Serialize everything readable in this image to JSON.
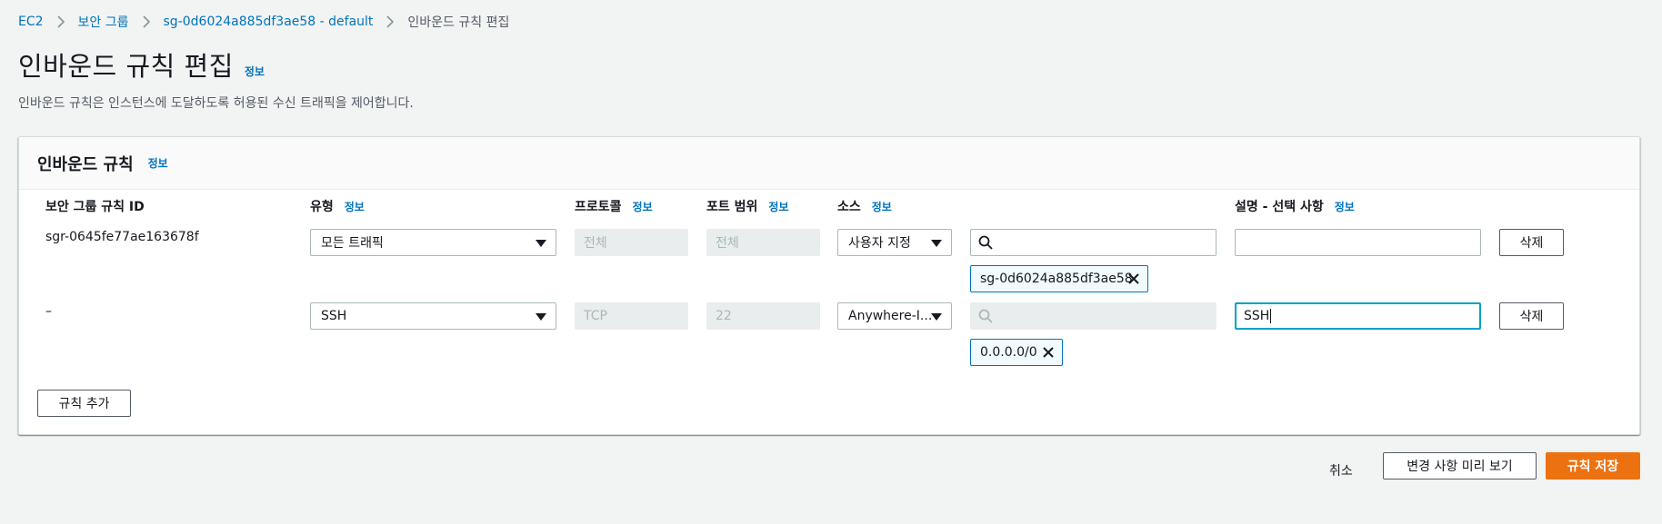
{
  "breadcrumb": [
    "EC2",
    "보안 그룹",
    "sg-0d6024a885df3ae58 - default",
    "인바운드 규칙 편집"
  ],
  "page": {
    "title": "인바운드 규칙 편집",
    "info": "정보",
    "description": "인바운드 규칙은 인스턴스에 도달하도록 허용된 수신 트래픽을 제어합니다."
  },
  "panel": {
    "title": "인바운드 규칙",
    "info": "정보",
    "columns": {
      "rule_id": "보안 그룹 규칙 ID",
      "type": "유형",
      "protocol": "프로토콜",
      "port_range": "포트 범위",
      "source": "소스",
      "description": "설명 - 선택 사항"
    },
    "column_info": "정보",
    "rows": [
      {
        "rule_id": "sgr-0645fe77ae163678f",
        "type": "모든 트래픽",
        "protocol": "전체",
        "port_range": "전체",
        "source": "사용자 지정",
        "search_value": "",
        "token": "sg-0d6024a885df3ae58",
        "description": "",
        "delete": "삭제"
      },
      {
        "rule_id": "–",
        "type": "SSH",
        "protocol": "TCP",
        "port_range": "22",
        "source": "Anywhere-I...",
        "search_value": "",
        "token": "0.0.0.0/0",
        "description": "SSH",
        "delete": "삭제"
      }
    ],
    "add_rule": "규칙 추가"
  },
  "footer": {
    "cancel": "취소",
    "preview": "변경 사항 미리 보기",
    "save": "규칙 저장"
  },
  "colors": {
    "link": "#0073bb",
    "primary": "#ec7211",
    "focus": "#00a1c9",
    "background": "#f2f3f3"
  }
}
